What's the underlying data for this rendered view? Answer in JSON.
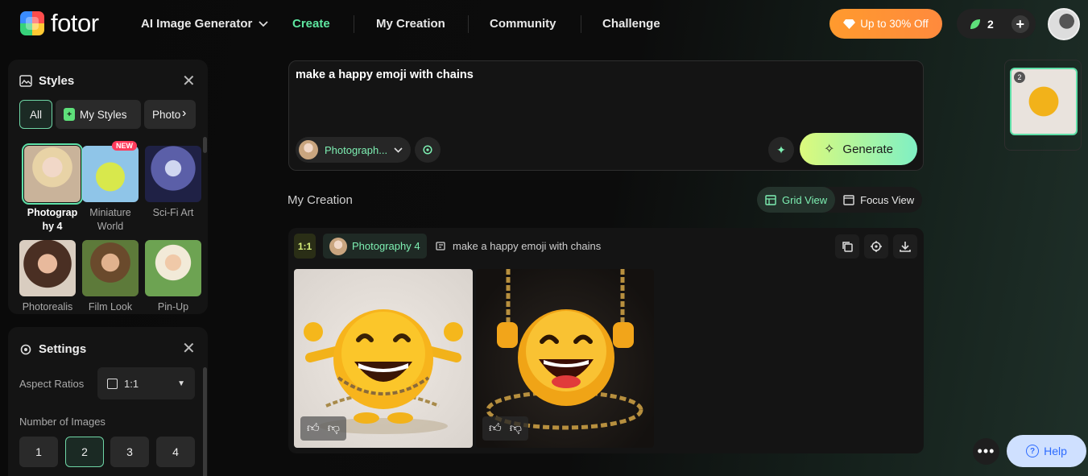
{
  "header": {
    "logo": "fotor",
    "nav": [
      {
        "label": "AI Image Generator"
      },
      {
        "label": "Create"
      },
      {
        "label": "My Creation"
      },
      {
        "label": "Community"
      },
      {
        "label": "Challenge"
      }
    ],
    "promo": "Up to 30% Off",
    "credits": "2"
  },
  "styles_panel": {
    "title": "Styles",
    "tabs": [
      "All",
      "My Styles",
      "Photo"
    ],
    "new_badge": "NEW",
    "items": [
      {
        "label": "Photograp hy 4"
      },
      {
        "label": "Miniature World"
      },
      {
        "label": "Sci-Fi Art"
      },
      {
        "label": "Photorealis"
      },
      {
        "label": "Film Look"
      },
      {
        "label": "Pin-Up"
      }
    ]
  },
  "settings_panel": {
    "title": "Settings",
    "aspect_label": "Aspect Ratios",
    "aspect_value": "1:1",
    "count_label": "Number of Images",
    "counts": [
      "1",
      "2",
      "3",
      "4"
    ],
    "selected_count": "2"
  },
  "prompt": {
    "text": "make a happy emoji with chains",
    "style": "Photograph...",
    "generate": "Generate"
  },
  "creation": {
    "title": "My Creation",
    "grid_view": "Grid View",
    "focus_view": "Focus View",
    "ratio": "1:1",
    "style": "Photography 4",
    "prompt": "make a happy emoji with chains"
  },
  "history": {
    "count": "2"
  },
  "help": "Help",
  "colors": {
    "accent": "#7ef0b3",
    "promo": "#ff9a2e",
    "help_bg": "#cfe0ff"
  }
}
